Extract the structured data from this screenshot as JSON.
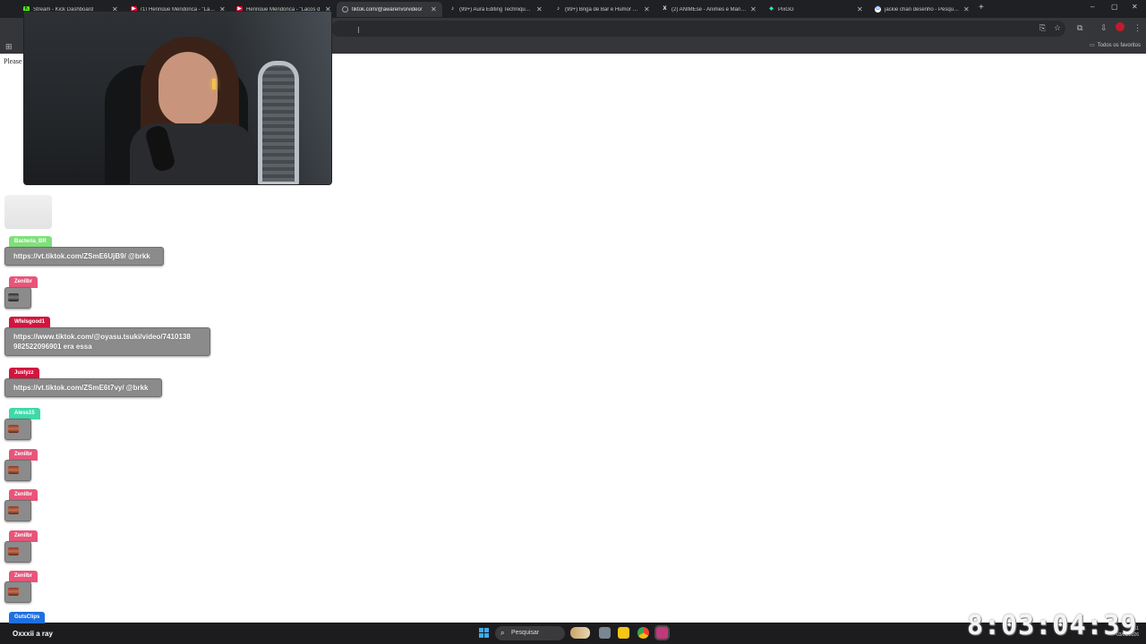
{
  "browser": {
    "tabs": [
      {
        "title": "Stream - Kick Dashboard",
        "favicon": "kick-icon",
        "color": "#53fc18",
        "active": false
      },
      {
        "title": "(1) Henrique Mendonça - \"Laços d",
        "favicon": "youtube-icon",
        "color": "#ff0033",
        "active": false
      },
      {
        "title": "Henrique Mendonça - \"Laços d",
        "favicon": "youtube-icon",
        "color": "#ff0033",
        "active": false
      },
      {
        "title": "tiktok.com/@awarenvo/video/",
        "favicon": "loading-icon",
        "color": "#9aa0a6",
        "active": true
      },
      {
        "title": "(99+) Aura Editing Techniques !",
        "favicon": "tiktok-icon",
        "color": "#ffffff",
        "active": false
      },
      {
        "title": "(99+) Briga de Bar e Humor com",
        "favicon": "tiktok-icon",
        "color": "#ffffff",
        "active": false
      },
      {
        "title": "(2) ANIMEse - Animes e Mangá",
        "favicon": "x-icon",
        "color": "#ffffff",
        "active": false
      },
      {
        "title": "PixGG",
        "favicon": "pixgg-icon",
        "color": "#2ee6c0",
        "active": false
      },
      {
        "title": "jackie chan desenho - Pesquisa",
        "favicon": "google-icon",
        "color": "#4285f4",
        "active": false
      }
    ],
    "new_tab_label": "+",
    "window_controls": [
      "–",
      "▢",
      "✕"
    ],
    "bookmarks_all": "Todos os favoritos"
  },
  "page": {
    "please_text": "Please"
  },
  "chat": {
    "messages": [
      {
        "user": "Bacteria_BR",
        "user_color": "#7fe07a",
        "text": "https://vt.tiktok.com/ZSmE6UjB9/ @brkk"
      },
      {
        "user": "Zenilbr",
        "user_color": "#e8557a",
        "emote": "emote"
      },
      {
        "user": "Wfelsgood1",
        "user_color": "#d3143f",
        "text_lines": [
          "https://www.tiktok.com/@oyasu.tsuki/video/7410138",
          "982522096901 era essa"
        ]
      },
      {
        "user": "Justyzz",
        "user_color": "#d3143f",
        "text": "https://vt.tiktok.com/ZSmE6t7vy/ @brkk"
      },
      {
        "user": "Aless15",
        "user_color": "#3fd9a9",
        "emote": "emote"
      },
      {
        "user": "Zenilbr",
        "user_color": "#e8557a",
        "emote": "emote"
      },
      {
        "user": "Zenilbr",
        "user_color": "#e8557a",
        "emote": "emote"
      },
      {
        "user": "Zenilbr",
        "user_color": "#e8557a",
        "emote": "emote"
      },
      {
        "user": "Zenilbr",
        "user_color": "#e8557a",
        "emote": "emote"
      },
      {
        "user": "GutsClips",
        "user_color": "#1f6fe0",
        "text": "Oxxxii a ray"
      }
    ]
  },
  "taskbar": {
    "search_placeholder": "Pesquisar",
    "system_date": "03/03/2026",
    "system_time": "8:11"
  },
  "stream_clock": "8:03:04:39"
}
